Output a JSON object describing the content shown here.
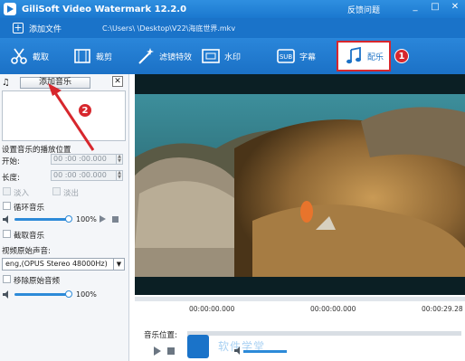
{
  "app": {
    "title": "GiliSoft Video Watermark 12.2.0",
    "feedback": "反馈问题",
    "window_buttons": [
      "_",
      "□",
      "✕"
    ]
  },
  "pathbar": {
    "add_file_label": "添加文件",
    "file_path": "C:\\Users\\           \\Desktop\\V22\\海底世界.mkv"
  },
  "toolbar": {
    "tools": [
      {
        "label": "截取",
        "icon": "scissors-icon"
      },
      {
        "label": "裁剪",
        "icon": "crop-icon"
      },
      {
        "label": "滤镜特效",
        "icon": "magic-wand-icon"
      },
      {
        "label": "水印",
        "icon": "watermark-icon"
      },
      {
        "label": "字幕",
        "icon": "subtitle-icon"
      },
      {
        "label": "配乐",
        "icon": "music-note-icon"
      }
    ],
    "active_tab": "配乐"
  },
  "annotations": {
    "badge1": "1",
    "badge2": "2",
    "color": "#d7272d"
  },
  "left_panel": {
    "add_music_button": "添加音乐",
    "close_label": "✕",
    "section_title": "设置音乐的播放位置",
    "start_label": "开始:",
    "start_value": "00 :00 :00.000",
    "length_label": "长度:",
    "length_value": "00 :00 :00.000",
    "fade_in_label": "淡入",
    "fade_out_label": "淡出",
    "loop_label": "循环音乐",
    "music_volume_pct": "100%",
    "music_volume_level": 1.0,
    "trim_music_label": "截取音乐",
    "original_audio_title": "视频原始声音:",
    "original_audio_option": "eng,(OPUS Stereo 48000Hz)",
    "remove_original_label": "移除原始音频",
    "original_volume_pct": "100%",
    "original_volume_level": 1.0
  },
  "player": {
    "time_start": "00:00:00.000",
    "time_middle": "00:00:00.000",
    "time_end": "00:00:29.28",
    "music_position_label": "音乐位置:",
    "watermark_text": "软件学堂"
  }
}
